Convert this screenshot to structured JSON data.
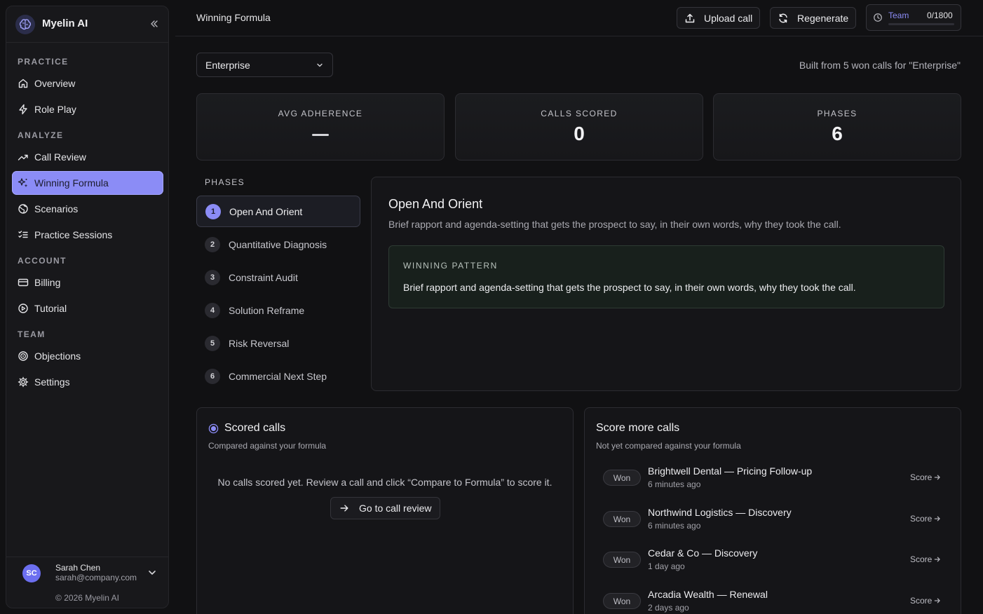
{
  "brand": {
    "name": "Myelin AI"
  },
  "sidebar": {
    "sections": {
      "practice": "PRACTICE",
      "analyze": "ANALYZE",
      "account": "ACCOUNT",
      "team": "TEAM"
    },
    "items": {
      "overview": "Overview",
      "role_play": "Role Play",
      "call_review": "Call Review",
      "winning_formula": "Winning Formula",
      "scenarios": "Scenarios",
      "practice_sessions": "Practice Sessions",
      "billing": "Billing",
      "tutorial": "Tutorial",
      "objections": "Objections",
      "settings": "Settings"
    },
    "active_item": "winning_formula",
    "user": {
      "initials": "SC",
      "name": "Sarah Chen",
      "email": "sarah@company.com"
    },
    "copyright": "© 2026 Myelin AI"
  },
  "header": {
    "title": "Winning Formula",
    "upload_label": "Upload call",
    "regenerate_label": "Regenerate",
    "team_label": "Team",
    "team_count": "0/1800",
    "team_progress": 0
  },
  "filter": {
    "selected": "Enterprise",
    "built_from": "Built from 5 won calls for \"Enterprise\""
  },
  "stats": {
    "avg_adherence": {
      "label": "AVG ADHERENCE",
      "value": "—"
    },
    "calls_scored": {
      "label": "CALLS SCORED",
      "value": "0"
    },
    "phases": {
      "label": "PHASES",
      "value": "6"
    }
  },
  "phases": {
    "heading": "PHASES",
    "items": [
      {
        "num": "1",
        "label": "Open And Orient"
      },
      {
        "num": "2",
        "label": "Quantitative Diagnosis"
      },
      {
        "num": "3",
        "label": "Constraint Audit"
      },
      {
        "num": "4",
        "label": "Solution Reframe"
      },
      {
        "num": "5",
        "label": "Risk Reversal"
      },
      {
        "num": "6",
        "label": "Commercial Next Step"
      }
    ]
  },
  "detail": {
    "title": "Open And Orient",
    "description": "Brief rapport and agenda-setting that gets the prospect to say, in their own words, why they took the call.",
    "pattern_label": "WINNING PATTERN",
    "pattern_text": "Brief rapport and agenda-setting that gets the prospect to say, in their own words, why they took the call."
  },
  "scored_calls": {
    "title": "Scored calls",
    "subtitle": "Compared against your formula",
    "empty_text": "No calls scored yet. Review a call and click “Compare to Formula” to score it.",
    "button_label": "Go to call review"
  },
  "score_more": {
    "title": "Score more calls",
    "subtitle": "Not yet compared against your formula",
    "score_label": "Score",
    "calls": [
      {
        "status": "Won",
        "name": "Brightwell Dental — Pricing Follow-up",
        "time": "6 minutes ago"
      },
      {
        "status": "Won",
        "name": "Northwind Logistics — Discovery",
        "time": "6 minutes ago"
      },
      {
        "status": "Won",
        "name": "Cedar & Co — Discovery",
        "time": "1 day ago"
      },
      {
        "status": "Won",
        "name": "Arcadia Wealth — Renewal",
        "time": "2 days ago"
      }
    ]
  },
  "colors": {
    "accent": "#8b8cf6",
    "background": "#111113",
    "panel": "#151518"
  }
}
